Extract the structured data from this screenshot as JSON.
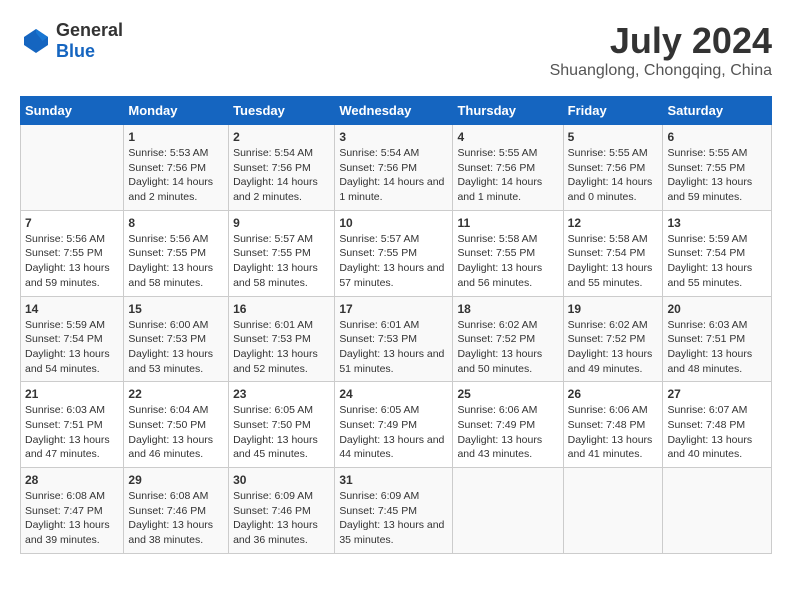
{
  "header": {
    "logo_general": "General",
    "logo_blue": "Blue",
    "title": "July 2024",
    "subtitle": "Shuanglong, Chongqing, China"
  },
  "calendar": {
    "days_of_week": [
      "Sunday",
      "Monday",
      "Tuesday",
      "Wednesday",
      "Thursday",
      "Friday",
      "Saturday"
    ],
    "weeks": [
      [
        {
          "day": "",
          "sunrise": "",
          "sunset": "",
          "daylight": ""
        },
        {
          "day": "1",
          "sunrise": "Sunrise: 5:53 AM",
          "sunset": "Sunset: 7:56 PM",
          "daylight": "Daylight: 14 hours and 2 minutes."
        },
        {
          "day": "2",
          "sunrise": "Sunrise: 5:54 AM",
          "sunset": "Sunset: 7:56 PM",
          "daylight": "Daylight: 14 hours and 2 minutes."
        },
        {
          "day": "3",
          "sunrise": "Sunrise: 5:54 AM",
          "sunset": "Sunset: 7:56 PM",
          "daylight": "Daylight: 14 hours and 1 minute."
        },
        {
          "day": "4",
          "sunrise": "Sunrise: 5:55 AM",
          "sunset": "Sunset: 7:56 PM",
          "daylight": "Daylight: 14 hours and 1 minute."
        },
        {
          "day": "5",
          "sunrise": "Sunrise: 5:55 AM",
          "sunset": "Sunset: 7:56 PM",
          "daylight": "Daylight: 14 hours and 0 minutes."
        },
        {
          "day": "6",
          "sunrise": "Sunrise: 5:55 AM",
          "sunset": "Sunset: 7:55 PM",
          "daylight": "Daylight: 13 hours and 59 minutes."
        }
      ],
      [
        {
          "day": "7",
          "sunrise": "Sunrise: 5:56 AM",
          "sunset": "Sunset: 7:55 PM",
          "daylight": "Daylight: 13 hours and 59 minutes."
        },
        {
          "day": "8",
          "sunrise": "Sunrise: 5:56 AM",
          "sunset": "Sunset: 7:55 PM",
          "daylight": "Daylight: 13 hours and 58 minutes."
        },
        {
          "day": "9",
          "sunrise": "Sunrise: 5:57 AM",
          "sunset": "Sunset: 7:55 PM",
          "daylight": "Daylight: 13 hours and 58 minutes."
        },
        {
          "day": "10",
          "sunrise": "Sunrise: 5:57 AM",
          "sunset": "Sunset: 7:55 PM",
          "daylight": "Daylight: 13 hours and 57 minutes."
        },
        {
          "day": "11",
          "sunrise": "Sunrise: 5:58 AM",
          "sunset": "Sunset: 7:55 PM",
          "daylight": "Daylight: 13 hours and 56 minutes."
        },
        {
          "day": "12",
          "sunrise": "Sunrise: 5:58 AM",
          "sunset": "Sunset: 7:54 PM",
          "daylight": "Daylight: 13 hours and 55 minutes."
        },
        {
          "day": "13",
          "sunrise": "Sunrise: 5:59 AM",
          "sunset": "Sunset: 7:54 PM",
          "daylight": "Daylight: 13 hours and 55 minutes."
        }
      ],
      [
        {
          "day": "14",
          "sunrise": "Sunrise: 5:59 AM",
          "sunset": "Sunset: 7:54 PM",
          "daylight": "Daylight: 13 hours and 54 minutes."
        },
        {
          "day": "15",
          "sunrise": "Sunrise: 6:00 AM",
          "sunset": "Sunset: 7:53 PM",
          "daylight": "Daylight: 13 hours and 53 minutes."
        },
        {
          "day": "16",
          "sunrise": "Sunrise: 6:01 AM",
          "sunset": "Sunset: 7:53 PM",
          "daylight": "Daylight: 13 hours and 52 minutes."
        },
        {
          "day": "17",
          "sunrise": "Sunrise: 6:01 AM",
          "sunset": "Sunset: 7:53 PM",
          "daylight": "Daylight: 13 hours and 51 minutes."
        },
        {
          "day": "18",
          "sunrise": "Sunrise: 6:02 AM",
          "sunset": "Sunset: 7:52 PM",
          "daylight": "Daylight: 13 hours and 50 minutes."
        },
        {
          "day": "19",
          "sunrise": "Sunrise: 6:02 AM",
          "sunset": "Sunset: 7:52 PM",
          "daylight": "Daylight: 13 hours and 49 minutes."
        },
        {
          "day": "20",
          "sunrise": "Sunrise: 6:03 AM",
          "sunset": "Sunset: 7:51 PM",
          "daylight": "Daylight: 13 hours and 48 minutes."
        }
      ],
      [
        {
          "day": "21",
          "sunrise": "Sunrise: 6:03 AM",
          "sunset": "Sunset: 7:51 PM",
          "daylight": "Daylight: 13 hours and 47 minutes."
        },
        {
          "day": "22",
          "sunrise": "Sunrise: 6:04 AM",
          "sunset": "Sunset: 7:50 PM",
          "daylight": "Daylight: 13 hours and 46 minutes."
        },
        {
          "day": "23",
          "sunrise": "Sunrise: 6:05 AM",
          "sunset": "Sunset: 7:50 PM",
          "daylight": "Daylight: 13 hours and 45 minutes."
        },
        {
          "day": "24",
          "sunrise": "Sunrise: 6:05 AM",
          "sunset": "Sunset: 7:49 PM",
          "daylight": "Daylight: 13 hours and 44 minutes."
        },
        {
          "day": "25",
          "sunrise": "Sunrise: 6:06 AM",
          "sunset": "Sunset: 7:49 PM",
          "daylight": "Daylight: 13 hours and 43 minutes."
        },
        {
          "day": "26",
          "sunrise": "Sunrise: 6:06 AM",
          "sunset": "Sunset: 7:48 PM",
          "daylight": "Daylight: 13 hours and 41 minutes."
        },
        {
          "day": "27",
          "sunrise": "Sunrise: 6:07 AM",
          "sunset": "Sunset: 7:48 PM",
          "daylight": "Daylight: 13 hours and 40 minutes."
        }
      ],
      [
        {
          "day": "28",
          "sunrise": "Sunrise: 6:08 AM",
          "sunset": "Sunset: 7:47 PM",
          "daylight": "Daylight: 13 hours and 39 minutes."
        },
        {
          "day": "29",
          "sunrise": "Sunrise: 6:08 AM",
          "sunset": "Sunset: 7:46 PM",
          "daylight": "Daylight: 13 hours and 38 minutes."
        },
        {
          "day": "30",
          "sunrise": "Sunrise: 6:09 AM",
          "sunset": "Sunset: 7:46 PM",
          "daylight": "Daylight: 13 hours and 36 minutes."
        },
        {
          "day": "31",
          "sunrise": "Sunrise: 6:09 AM",
          "sunset": "Sunset: 7:45 PM",
          "daylight": "Daylight: 13 hours and 35 minutes."
        },
        {
          "day": "",
          "sunrise": "",
          "sunset": "",
          "daylight": ""
        },
        {
          "day": "",
          "sunrise": "",
          "sunset": "",
          "daylight": ""
        },
        {
          "day": "",
          "sunrise": "",
          "sunset": "",
          "daylight": ""
        }
      ]
    ]
  }
}
